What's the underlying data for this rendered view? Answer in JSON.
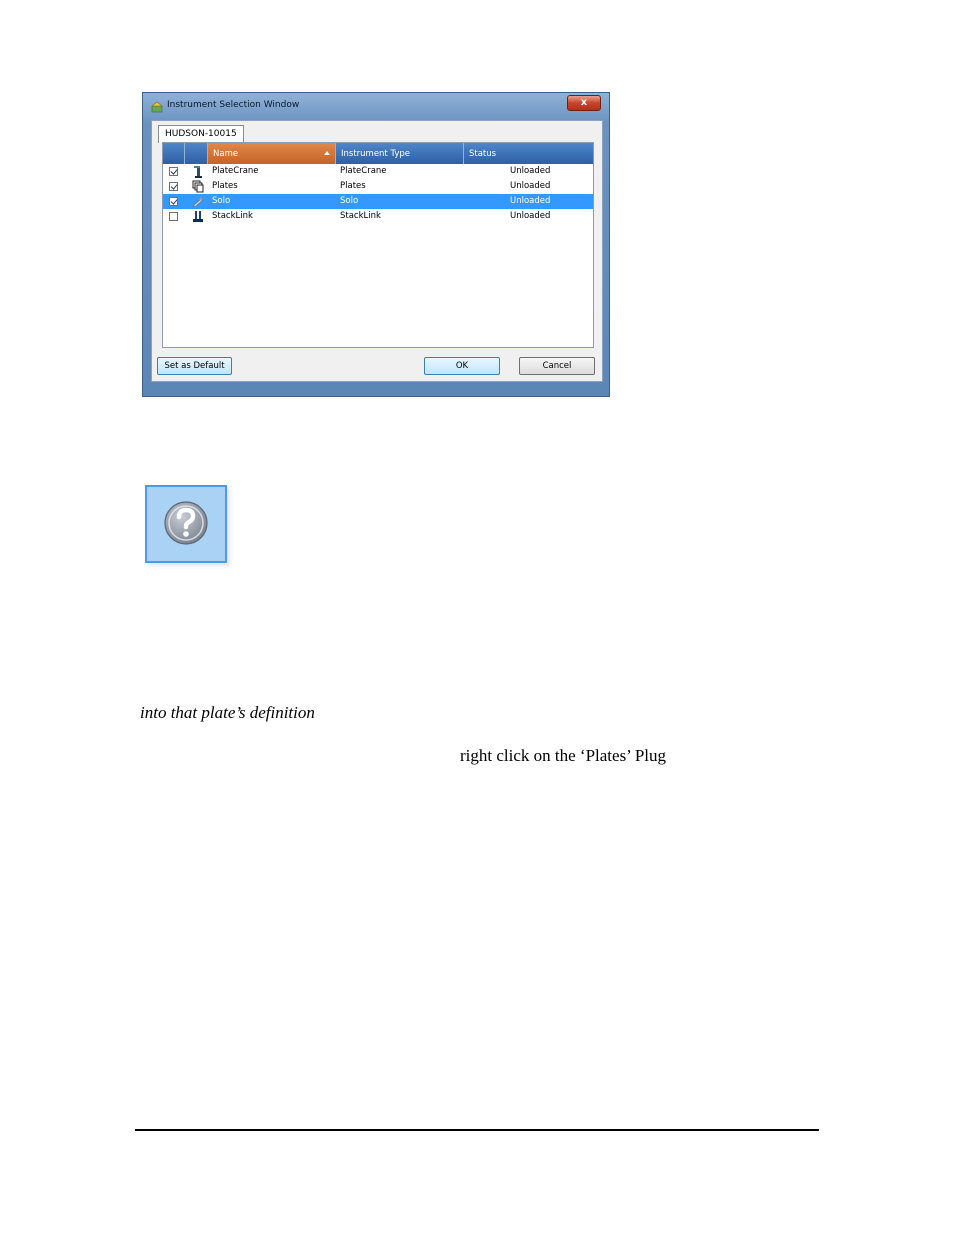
{
  "dialog": {
    "title": "Instrument Selection Window",
    "close_label": "x",
    "tab_label": "HUDSON-10015",
    "columns": [
      "Name",
      "Instrument Type",
      "Status"
    ],
    "rows": [
      {
        "name": "PlateCrane",
        "type": "PlateCrane",
        "status": "Unloaded",
        "checked": true,
        "icon": "platecrane-icon"
      },
      {
        "name": "Plates",
        "type": "Plates",
        "status": "Unloaded",
        "checked": true,
        "icon": "plates-icon"
      },
      {
        "name": "Solo",
        "type": "Solo",
        "status": "Unloaded",
        "checked": true,
        "icon": "solo-icon",
        "selected": true
      },
      {
        "name": "StackLink",
        "type": "StackLink",
        "status": "Unloaded",
        "checked": false,
        "icon": "stacklink-icon"
      }
    ],
    "set_default_label": "Set as Default",
    "ok_label": "OK",
    "cancel_label": "Cancel",
    "colors": {
      "selection": "#3399ff",
      "header": "#2d5fa3",
      "sorted_header": "#c56327"
    }
  },
  "help": {
    "icon": "question-mark-icon"
  },
  "text": {
    "line1": "into that plate’s definition",
    "line2": "right click on the ‘Plates’ Plug"
  }
}
